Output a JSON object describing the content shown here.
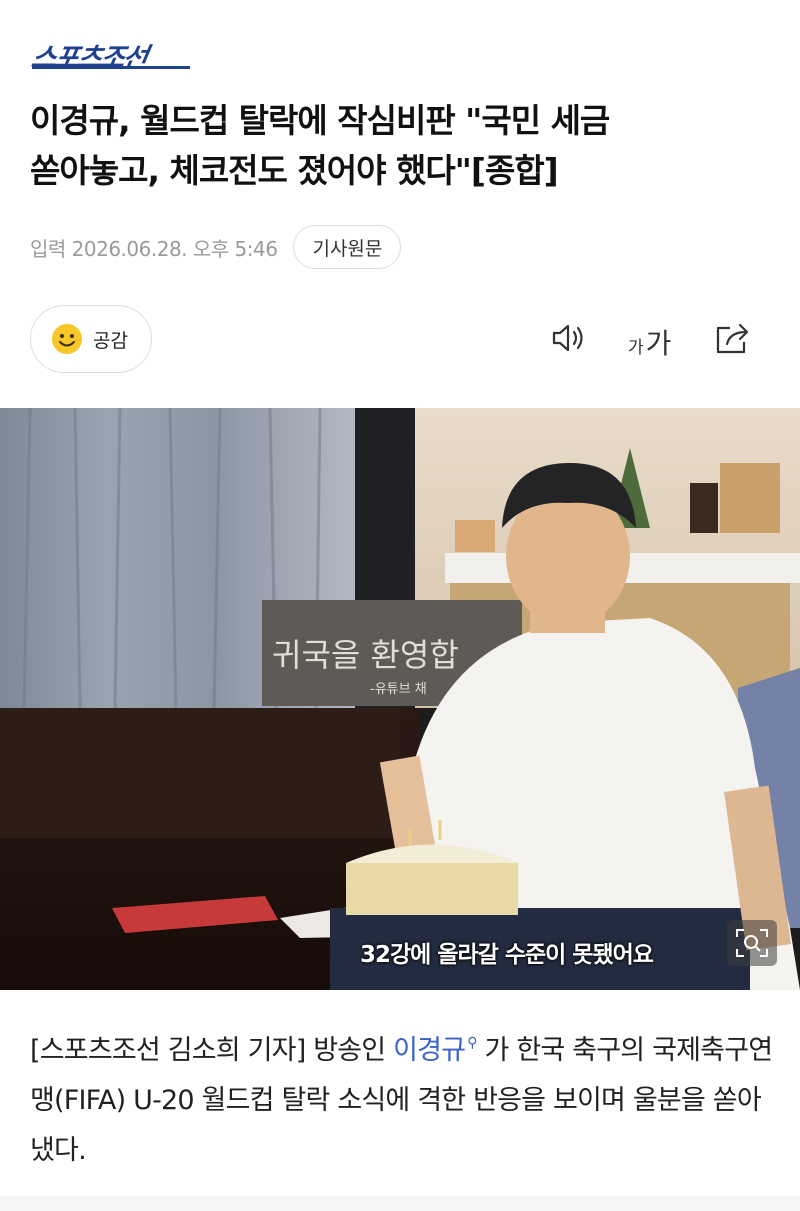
{
  "header": {
    "logo_text": "스포츠조선"
  },
  "article": {
    "title_line1": "이경규, 월드컵 탈락에 작심비판 \"국민 세금",
    "title_line2": "쏟아놓고, 체코전도 졌어야 했다\"[종합]",
    "date": "입력 2026.06.28. 오후 5:46",
    "origin_label": "기사원문"
  },
  "actions": {
    "empathy_label": "공감",
    "font_small": "가",
    "font_large": "가"
  },
  "photo": {
    "caption": "32강에 올라갈 수준이 못됐어요",
    "poster_text": "귀국을 환영합",
    "poster_sub": "-유튜브 채"
  },
  "body": {
    "part1": "[스포츠조선 김소희 기자] 방송인 ",
    "person": "이경규",
    "part2": " 가 한국 축구의 국제축구연맹(FIFA) U-20 월드컵 탈락 소식에 격한 반응을 보이며 울분을 쏟아냈다."
  },
  "colors": {
    "brand": "#1f3f8f",
    "link": "#3a62c8",
    "meta": "#9a9a9a"
  }
}
